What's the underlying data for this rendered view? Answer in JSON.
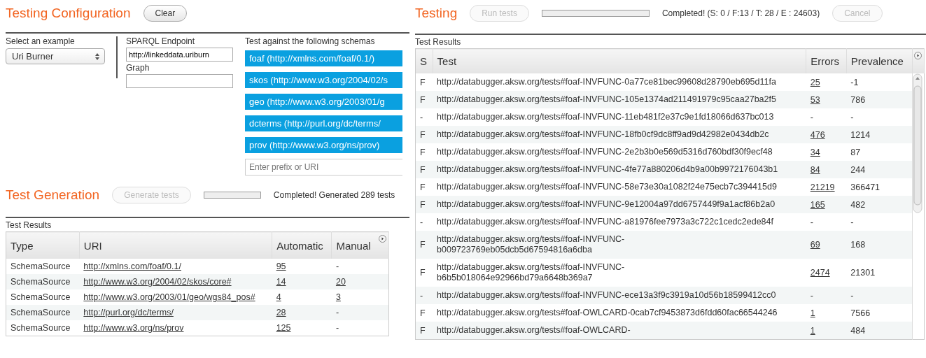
{
  "configuration": {
    "title": "Testing Configuration",
    "clear_button": {
      "label": "Clear",
      "disabled": false
    },
    "example": {
      "label": "Select an example",
      "value": "Uri Burner"
    },
    "endpoint": {
      "label": "SPARQL Endpoint",
      "value": "http://linkeddata.uriburn"
    },
    "graph": {
      "label": "Graph"
    },
    "schemas": {
      "label": "Test against the following schemas",
      "items": [
        "foaf (http://xmlns.com/foaf/0.1/)",
        "skos (http://www.w3.org/2004/02/s",
        "geo (http://www.w3.org/2003/01/g",
        "dcterms (http://purl.org/dc/terms/",
        "prov (http://www.w3.org/ns/prov)"
      ],
      "placeholder": "Enter prefix or URI"
    }
  },
  "generation": {
    "title": "Test Generation",
    "button": {
      "label": "Generate tests",
      "disabled": true
    },
    "progress": {
      "level": 0
    },
    "status": "Completed! Generated 289 tests",
    "results_label": "Test Results",
    "columns": [
      "Type",
      "URI",
      "Automatic",
      "Manual"
    ],
    "rows": [
      {
        "type": "SchemaSource",
        "uri": "http://xmlns.com/foaf/0.1/",
        "automatic": {
          "text": "95",
          "link": true
        },
        "manual": {
          "text": "-",
          "link": false
        }
      },
      {
        "type": "SchemaSource",
        "uri": "http://www.w3.org/2004/02/skos/core#",
        "automatic": {
          "text": "14",
          "link": true
        },
        "manual": {
          "text": "20",
          "link": true
        }
      },
      {
        "type": "SchemaSource",
        "uri": "http://www.w3.org/2003/01/geo/wgs84_pos#",
        "automatic": {
          "text": "4",
          "link": true
        },
        "manual": {
          "text": "3",
          "link": true
        }
      },
      {
        "type": "SchemaSource",
        "uri": "http://purl.org/dc/terms/",
        "automatic": {
          "text": "28",
          "link": true
        },
        "manual": {
          "text": "-",
          "link": false
        }
      },
      {
        "type": "SchemaSource",
        "uri": "http://www.w3.org/ns/prov",
        "automatic": {
          "text": "125",
          "link": true
        },
        "manual": {
          "text": "-",
          "link": false
        }
      }
    ]
  },
  "testing": {
    "title": "Testing",
    "run_button": {
      "label": "Run tests",
      "disabled": true
    },
    "progress": {
      "level": 0
    },
    "status": "Completed! (S: 0 / F:13 / T: 28 / E : 24603)",
    "cancel_button": {
      "label": "Cancel",
      "disabled": true
    },
    "results_label": "Test Results",
    "columns": [
      "S",
      "Test",
      "Errors",
      "Prevalence"
    ],
    "rows": [
      {
        "s": "F",
        "test": [
          "http://databugger.aksw.org/tests#foaf-INVFUNC-0a77ce81bec99608d28790eb695d11fa"
        ],
        "errors": {
          "text": "25",
          "link": true
        },
        "prevalence": "-1"
      },
      {
        "s": "F",
        "test": [
          "http://databugger.aksw.org/tests#foaf-INVFUNC-105e1374ad211491979c95caa27ba2f5"
        ],
        "errors": {
          "text": "53",
          "link": true
        },
        "prevalence": "786"
      },
      {
        "s": "-",
        "test": [
          "http://databugger.aksw.org/tests#foaf-INVFUNC-11eb481f2e37c9e1fd18066d637bc013"
        ],
        "errors": {
          "text": "-",
          "link": false
        },
        "prevalence": "-"
      },
      {
        "s": "F",
        "test": [
          "http://databugger.aksw.org/tests#foaf-INVFUNC-18fb0cf9dc8ff9ad9d42982e0434db2c"
        ],
        "errors": {
          "text": "476",
          "link": true
        },
        "prevalence": "1214"
      },
      {
        "s": "F",
        "test": [
          "http://databugger.aksw.org/tests#foaf-INVFUNC-2e2b3b0e569d5316d760bdf30f9ecf48"
        ],
        "errors": {
          "text": "34",
          "link": true
        },
        "prevalence": "87"
      },
      {
        "s": "F",
        "test": [
          "http://databugger.aksw.org/tests#foaf-INVFUNC-4fe77a880206d4b9a00b9972176043b1"
        ],
        "errors": {
          "text": "84",
          "link": true
        },
        "prevalence": "244"
      },
      {
        "s": "F",
        "test": [
          "http://databugger.aksw.org/tests#foaf-INVFUNC-58e73e30a1082f24e75ecb7c394415d9"
        ],
        "errors": {
          "text": "21219",
          "link": true
        },
        "prevalence": "366471"
      },
      {
        "s": "F",
        "test": [
          "http://databugger.aksw.org/tests#foaf-INVFUNC-9e12004a97dd6757449f9a1acf86b2a0"
        ],
        "errors": {
          "text": "165",
          "link": true
        },
        "prevalence": "482"
      },
      {
        "s": "-",
        "test": [
          "http://databugger.aksw.org/tests#foaf-INVFUNC-a81976fee7973a3c722c1cedc2ede84f"
        ],
        "errors": {
          "text": "-",
          "link": false
        },
        "prevalence": "-"
      },
      {
        "s": "F",
        "test": [
          "http://databugger.aksw.org/tests#foaf-INVFUNC-",
          "b009723769eb05dcb5d67594816a6dba"
        ],
        "errors": {
          "text": "69",
          "link": true
        },
        "prevalence": "168"
      },
      {
        "s": "F",
        "test": [
          "http://databugger.aksw.org/tests#foaf-INVFUNC-",
          "b6b5b018064e92966bd79a6648b369a7"
        ],
        "errors": {
          "text": "2474",
          "link": true
        },
        "prevalence": "21301"
      },
      {
        "s": "-",
        "test": [
          "http://databugger.aksw.org/tests#foaf-INVFUNC-ece13a3f9c3919a10d56b18599412cc0"
        ],
        "errors": {
          "text": "-",
          "link": false
        },
        "prevalence": "-"
      },
      {
        "s": "F",
        "test": [
          "http://databugger.aksw.org/tests#foaf-OWLCARD-0cab7cf9453873d6fdd60fac66544246"
        ],
        "errors": {
          "text": "1",
          "link": true
        },
        "prevalence": "7566"
      },
      {
        "s": "F",
        "test": [
          "http://databugger.aksw.org/tests#foaf-OWLCARD-"
        ],
        "errors": {
          "text": "1",
          "link": true
        },
        "prevalence": "484"
      }
    ]
  }
}
